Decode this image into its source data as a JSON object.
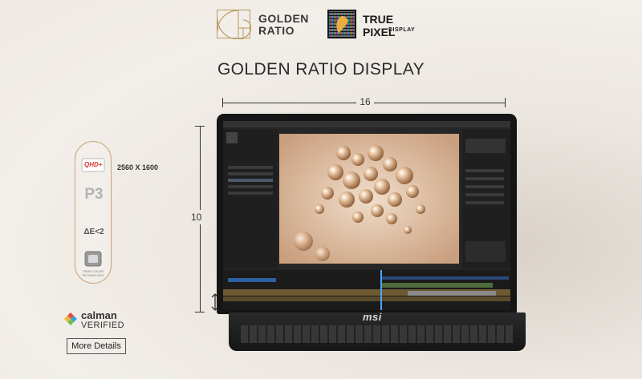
{
  "logos": {
    "golden_ratio": {
      "line1": "GOLDEN",
      "line2": "RATIO"
    },
    "true_pixel": {
      "title": "TRUE PIXEL",
      "subtitle": "DISPLAY"
    }
  },
  "heading": "GOLDEN RATIO DISPLAY",
  "dimensions": {
    "width_label": "16",
    "height_label": "10"
  },
  "specs": {
    "resolution_badge": "QHD+",
    "resolution": "2560 X 1600",
    "gamut": "P3",
    "delta_e": "ΔE<2",
    "true_color_line1": "TRUE COLOR",
    "true_color_line2": "TECHNOLOGY"
  },
  "calman": {
    "name": "calman",
    "verified": "VERIFIED"
  },
  "more_details": "More Details",
  "laptop_brand": "msi",
  "colors": {
    "accent_gold": "#c7a578",
    "text_dark": "#2b2b2b",
    "background": "#efe9e3"
  }
}
